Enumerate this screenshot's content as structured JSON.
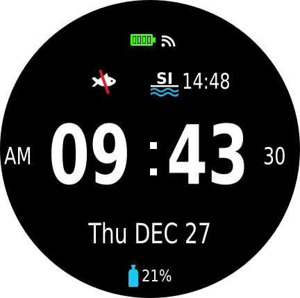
{
  "status": {
    "battery_icon": "battery-full-icon",
    "battery_color": "#39ff14",
    "signal_icon": "wireless-signal-icon"
  },
  "indicators": {
    "fish_icon": "no-fly-fish-icon",
    "fish_slash_color": "#e01b2b",
    "si_icon": "surface-interval-icon",
    "si_label": "SI",
    "si_wave_color": "#29b6e8",
    "surface_interval": "14:48"
  },
  "clock": {
    "ampm": "AM",
    "hours": "09",
    "minutes": "43",
    "seconds": "30"
  },
  "date": "Thu DEC 27",
  "tank": {
    "icon": "air-tank-icon",
    "icon_color": "#19c8ee",
    "pressure": "21%"
  }
}
